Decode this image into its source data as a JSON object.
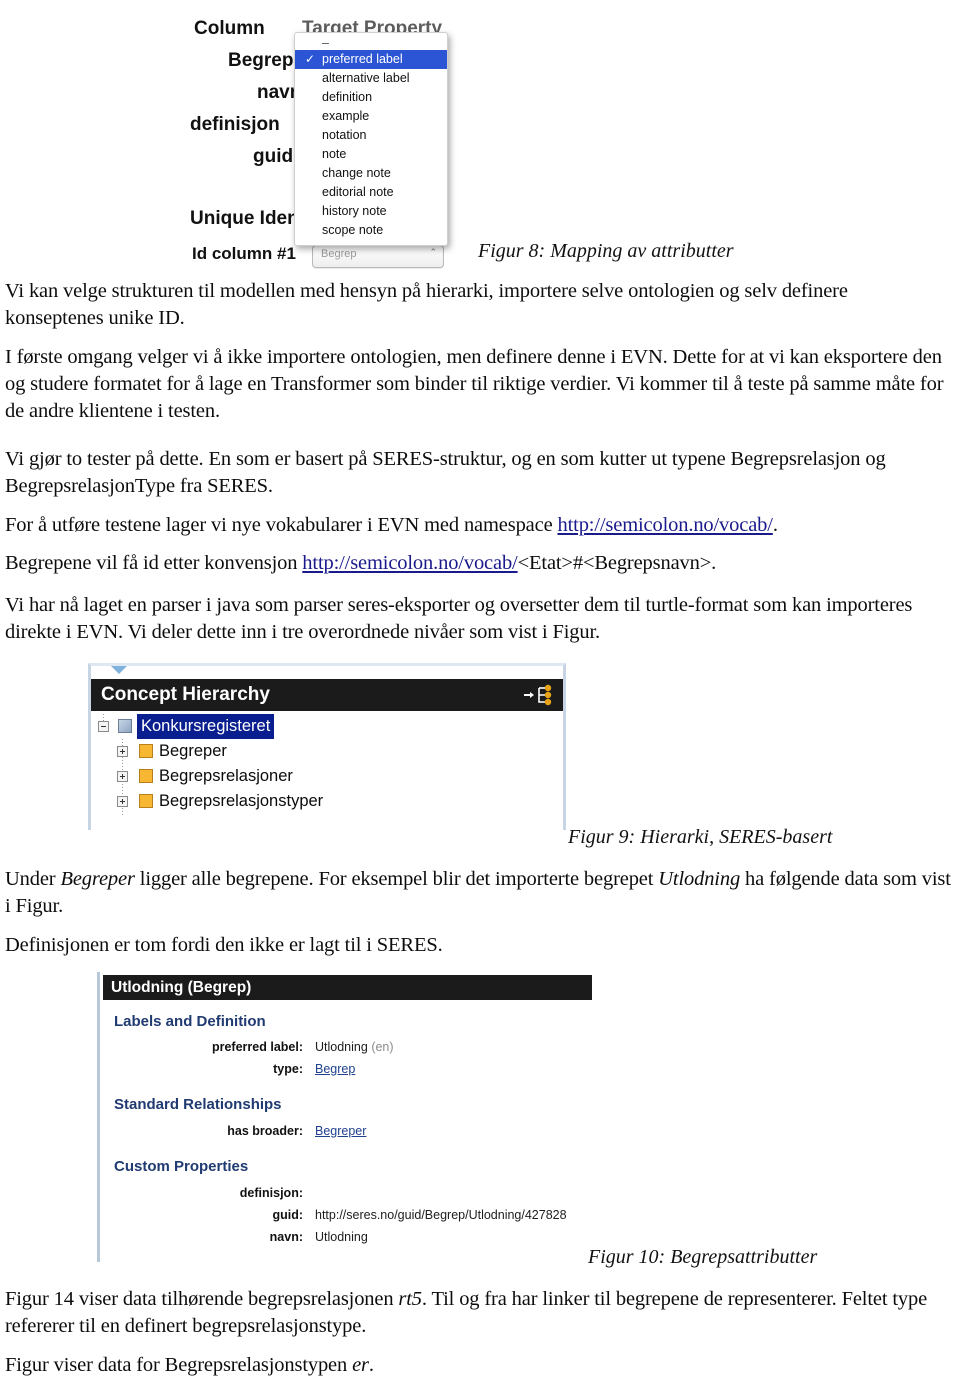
{
  "figure8": {
    "name": "Mapping av attributter dialog (cropped screenshot)",
    "table_headers": {
      "column": "Column",
      "target_property": "Target Property"
    },
    "rows": [
      {
        "column": "Begrep",
        "target_property": "preferred label"
      },
      {
        "column": "navn",
        "target_property": ""
      },
      {
        "column": "definisjon",
        "target_property": ""
      },
      {
        "column": "guid",
        "target_property": ""
      }
    ],
    "section_unique_identifiers": "Unique Identifiers",
    "id_column_label": "Id column #1",
    "id_column_value": "Begrep",
    "dropdown": {
      "selected": "preferred label",
      "items": [
        "–",
        "preferred label",
        "alternative label",
        "definition",
        "example",
        "notation",
        "note",
        "change note",
        "editorial note",
        "history note",
        "scope note"
      ],
      "check_glyph": "✓",
      "highlight_color": "#2b55d4"
    },
    "caption": "Figur 8: Mapping av attributter"
  },
  "body": {
    "p1_html": "Vi kan velge strukturen til modellen med hensyn på hierarki, importere selve ontologien og selv definere konseptenes unike ID.",
    "p2_html": "I første omgang velger vi å ikke importere ontologien, men definere denne i EVN. Dette for at vi kan eksportere den og studere formatet for å lage en Transformer som binder til riktige verdier. Vi kommer til å teste på samme måte for de andre klientene i testen.",
    "p3_html": "Vi gjør to tester på dette. En som er basert på SERES-struktur, og en som kutter ut typene Begrepsrelasjon og BegrepsrelasjonType fra SERES.",
    "p4_prefix": "For å utføre testene lager vi nye vokabularer i EVN med namespace ",
    "p4_link": "http://semicolon.no/vocab/",
    "p4_suffix": "",
    "p5_prefix": "Begrepene vil få id etter konvensjon ",
    "p5_link": "http://semicolon.no/vocab/",
    "p5_suffix": "<Etat>#<Begrepsnavn>.",
    "p6_html": "Vi har nå laget en parser i java som parser seres-eksporter og oversetter dem til turtle-format som kan importeres direkte i EVN. Vi deler dette inn i tre overordnede nivåer som vist i  Figur.",
    "p7_a": "Under ",
    "p7_i1": "Begreper",
    "p7_b": " ligger alle begrepene. For eksempel blir det importerte begrepet ",
    "p7_i2": "Utlodning",
    "p7_c": " ha følgende data som vist i  Figur.",
    "p8_html": "Definisjonen er tom fordi den ikke er lagt til i SERES.",
    "p9_a": "Figur 14 viser data tilhørende begrepsrelasjonen ",
    "p9_i": "rt5",
    "p9_b": ". Til og fra har linker til begrepene de representerer. Feltet type refererer til en definert begrepsrelasjonstype.",
    "p10_a": "Figur viser data for Begrepsrelasjonstypen ",
    "p10_i": "er",
    "p10_b": "."
  },
  "figure9": {
    "panel_title": "Concept Hierarchy",
    "toolbar_icon": "hierarchy-link-icon",
    "tree": [
      {
        "label": "Konkursregisteret",
        "level": 0,
        "expanded": true,
        "selected": true,
        "icon": "cube-icon"
      },
      {
        "label": "Begreper",
        "level": 1,
        "expanded": false,
        "selected": false,
        "icon": "folder-icon"
      },
      {
        "label": "Begrepsrelasjoner",
        "level": 1,
        "expanded": false,
        "selected": false,
        "icon": "folder-icon"
      },
      {
        "label": "Begrepsrelasjonstyper",
        "level": 1,
        "expanded": false,
        "selected": false,
        "icon": "folder-icon"
      }
    ],
    "selection_color": "#0a1f8f",
    "header_color": "#1b1b1b",
    "caption": "Figur 9: Hierarki, SERES-basert"
  },
  "figure10": {
    "panel_title": "Utlodning (Begrep)",
    "sections": [
      {
        "title": "Labels and Definition",
        "rows": [
          {
            "key": "preferred label:",
            "value": "Utlodning",
            "lang": "(en)",
            "link": false
          },
          {
            "key": "type:",
            "value": "Begrep",
            "lang": "",
            "link": true
          }
        ]
      },
      {
        "title": "Standard Relationships",
        "rows": [
          {
            "key": "has broader:",
            "value": "Begreper",
            "lang": "",
            "link": true
          }
        ]
      },
      {
        "title": "Custom Properties",
        "rows": [
          {
            "key": "definisjon:",
            "value": "",
            "lang": "",
            "link": false
          },
          {
            "key": "guid:",
            "value": "http://seres.no/guid/Begrep/Utlodning/427828",
            "lang": "",
            "link": false
          },
          {
            "key": "navn:",
            "value": "Utlodning",
            "lang": "",
            "link": false
          }
        ]
      }
    ],
    "section_color": "#203a72",
    "header_color": "#1b1b1b",
    "caption": "Figur 10: Begrepsattributter"
  }
}
